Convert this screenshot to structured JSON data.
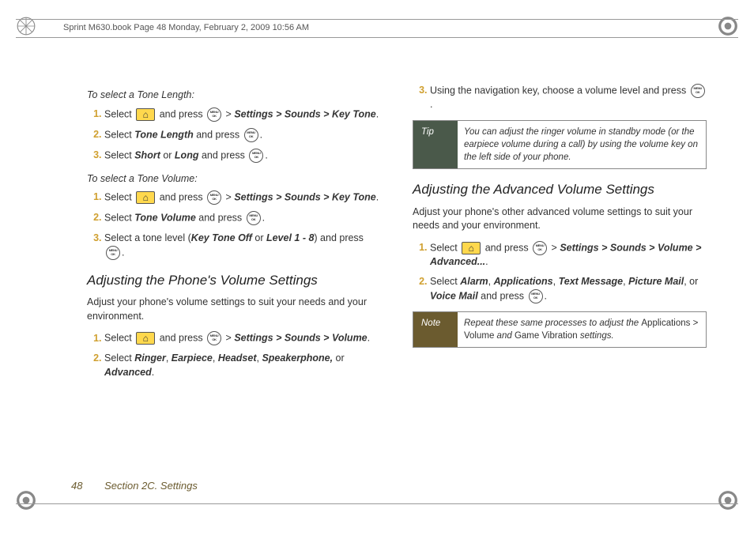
{
  "header": {
    "text": "Sprint M630.book  Page 48  Monday, February 2, 2009  10:56 AM"
  },
  "left": {
    "sub1": "To select a Tone Length:",
    "l1a": "Select ",
    "l1b": " and press ",
    "l1c": " > ",
    "l1path": "Settings > Sounds > Key Tone",
    "l1end": ".",
    "l2a": "Select ",
    "l2b": "Tone Length",
    "l2c": " and press ",
    "l2end": ".",
    "l3a": "Select ",
    "l3s": "Short",
    "l3or": " or ",
    "l3l": "Long",
    "l3c": " and press ",
    "l3end": ".",
    "sub2": "To select a Tone Volume:",
    "v1a": "Select ",
    "v1b": " and press ",
    "v1c": " > ",
    "v1path": "Settings > Sounds > Key Tone",
    "v1end": ".",
    "v2a": "Select ",
    "v2b": "Tone Volume",
    "v2c": " and press ",
    "v2end": ".",
    "v3a": "Select a tone level (",
    "v3o": "Key Tone Off",
    "v3or": " or ",
    "v3lv": "Level 1 - 8",
    "v3b": ") and press ",
    "v3end": ".",
    "title1": "Adjusting the Phone's Volume Settings",
    "p1": "Adjust your phone's volume settings to suit your needs and your environment.",
    "p1_1a": "Select ",
    "p1_1b": " and press ",
    "p1_1c": " > ",
    "p1_1path": "Settings > Sounds > Volume",
    "p1_1end": ".",
    "p1_2a": "Select ",
    "p1_2r": "Ringer",
    "p1_2s": ", ",
    "p1_2e": "Earpiece",
    "p1_2h": "Headset",
    "p1_2sp": "Speakerphone,",
    "p1_2or": " or ",
    "p1_2ad": "Advanced",
    "p1_2end": "."
  },
  "right": {
    "r3a": "Using the navigation key, choose a volume level and press ",
    "r3end": ".",
    "tipLabel": "Tip",
    "tipText": "You can adjust the ringer volume in standby mode (or the earpiece volume during a call) by using the volume key on the left side of your phone.",
    "title2": "Adjusting the Advanced Volume Settings",
    "p2": "Adjust your phone's other advanced volume settings to suit your needs and your environment.",
    "a1a": "Select ",
    "a1b": " and press ",
    "a1c": " > ",
    "a1path": "Settings > Sounds > Volume > Advanced...",
    "a1end": ".",
    "a2a": "Select ",
    "a2al": "Alarm",
    "a2s": ", ",
    "a2ap": "Applications",
    "a2tm": "Text Message",
    "a2pm": "Picture Mail",
    "a2or": ", or ",
    "a2vm": "Voice Mail",
    "a2c": " and press ",
    "a2end": ".",
    "noteLabel": "Note",
    "noteA": "Repeat these same processes to adjust the ",
    "noteB": "Applications > Volume",
    "noteC": " and ",
    "noteD": "Game Vibration",
    "noteE": " settings."
  },
  "footer": {
    "page": "48",
    "section": "Section 2C. Settings"
  }
}
